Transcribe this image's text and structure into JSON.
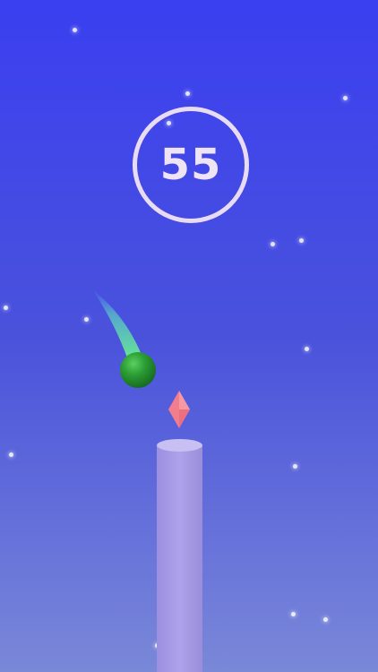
{
  "game": {
    "score": "55"
  },
  "colors": {
    "sky_top": "#3a3ff0",
    "sky_mid": "#4a52dc",
    "sky_bottom": "#7a88d8",
    "score_ring": "#e9dcf2",
    "ball": "#1f8a2c",
    "ball_highlight": "#5cd060",
    "trail": "#66e7a4",
    "gem": "#f27d8c",
    "pillar": "#a79be6",
    "pillar_top": "#c8bff2"
  },
  "icons": {
    "player": "ball-icon",
    "collectible": "diamond-gem-icon",
    "platform": "pillar-icon"
  }
}
